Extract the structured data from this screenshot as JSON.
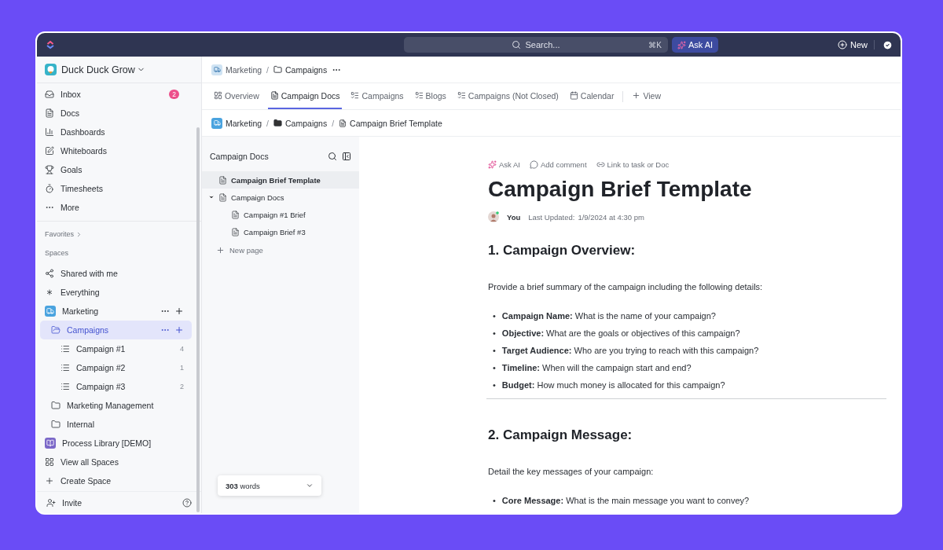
{
  "topbar": {
    "search": {
      "placeholder": "Search..."
    },
    "shortcut": "⌘K",
    "ask_ai": "Ask AI",
    "new": "New"
  },
  "sidebar": {
    "workspace": "Duck Duck Grow",
    "nav": [
      {
        "kind": "inbox",
        "label": "Inbox",
        "badge": "2"
      },
      {
        "kind": "docs",
        "label": "Docs"
      },
      {
        "kind": "dashboards",
        "label": "Dashboards"
      },
      {
        "kind": "whiteboards",
        "label": "Whiteboards"
      },
      {
        "kind": "goals",
        "label": "Goals"
      },
      {
        "kind": "timesheets",
        "label": "Timesheets"
      },
      {
        "kind": "more",
        "label": "More"
      }
    ],
    "favorites": "Favorites",
    "spaces_label": "Spaces",
    "spaces": [
      {
        "kind": "share",
        "label": "Shared with me",
        "selected": false,
        "actions": false
      },
      {
        "kind": "everything",
        "label": "Everything",
        "selected": false,
        "actions": false
      },
      {
        "kind": "space",
        "label": "Marketing",
        "color": "#4aa3df",
        "selected": false,
        "actions": true,
        "children": [
          {
            "kind": "folder",
            "label": "Campaigns",
            "selected": true,
            "actions": true,
            "children": [
              {
                "kind": "list",
                "label": "Campaign #1",
                "count": "4",
                "selected": false,
                "actions": false
              },
              {
                "kind": "list",
                "label": "Campaign #2",
                "count": "1",
                "selected": false,
                "actions": false
              },
              {
                "kind": "list",
                "label": "Campaign #3",
                "count": "2",
                "selected": false,
                "actions": false
              }
            ]
          },
          {
            "kind": "folder",
            "label": "Marketing Management",
            "selected": false,
            "actions": false
          },
          {
            "kind": "folder",
            "label": "Internal",
            "selected": false,
            "actions": false
          }
        ]
      },
      {
        "kind": "space",
        "label": "Process Library [DEMO]",
        "color": "#7b68c8",
        "selected": false,
        "actions": false
      },
      {
        "kind": "grid",
        "label": "View all Spaces",
        "selected": false,
        "actions": false
      },
      {
        "kind": "plus",
        "label": "Create Space",
        "selected": false,
        "actions": false
      }
    ],
    "invite": "Invite"
  },
  "header": {
    "breadcrumb": [
      {
        "label": "Marketing"
      },
      {
        "separator": "/",
        "label": "Campaigns"
      }
    ]
  },
  "tabs": [
    {
      "kind": "overview",
      "label": "Overview",
      "selected": false
    },
    {
      "kind": "doc",
      "label": "Campaign Docs",
      "selected": true
    },
    {
      "kind": "list",
      "label": "Campaigns",
      "selected": false
    },
    {
      "kind": "list",
      "label": "Blogs",
      "selected": false
    },
    {
      "kind": "list",
      "label": "Campaigns (Not Closed)",
      "selected": false
    },
    {
      "kind": "calendar",
      "label": "Calendar",
      "selected": false
    },
    {
      "kind": "add",
      "label": "View",
      "selected": false
    }
  ],
  "breadcrumb": [
    {
      "kind": "space",
      "label": "Marketing"
    },
    {
      "kind": "folder",
      "separator": "/",
      "label": "Campaigns"
    },
    {
      "kind": "doc",
      "separator": "/",
      "label": "Campaign Brief Template"
    }
  ],
  "doc_panel": {
    "title": "Campaign Docs",
    "pages": [
      {
        "label": "Campaign Brief Template",
        "selected": true,
        "expanded": false
      },
      {
        "label": "Campaign Docs",
        "selected": false,
        "expanded": true,
        "children": [
          {
            "label": "Campaign #1 Brief",
            "selected": false,
            "expanded": false
          },
          {
            "label": "Campaign Brief #3",
            "selected": false,
            "expanded": false
          }
        ]
      }
    ],
    "new_page": "New page"
  },
  "doc": {
    "actions": [
      {
        "kind": "ai",
        "label": "Ask AI"
      },
      {
        "kind": "comment",
        "label": "Add comment"
      },
      {
        "kind": "link",
        "label": "Link to task or Doc"
      }
    ],
    "title": "Campaign Brief Template",
    "author": "You",
    "updated_label": "Last Updated:",
    "updated": "1/9/2024 at 4:30 pm",
    "sections": [
      {
        "heading": "1. Campaign Overview:",
        "intro": "Provide a brief summary of the campaign including the following details:",
        "bullets": [
          {
            "marker": "•",
            "text": "**Campaign Name:** What is the name of your campaign?"
          },
          {
            "marker": "•",
            "text": "**Objective:** What are the goals or objectives of this campaign?"
          },
          {
            "marker": "•",
            "text": "**Target Audience:** Who are you trying to reach with this campaign?"
          },
          {
            "marker": "•",
            "text": "**Timeline:** When will the campaign start and end?"
          },
          {
            "marker": "•",
            "text": "**Budget:** How much money is allocated for this campaign?"
          }
        ],
        "divider": true
      },
      {
        "heading": "2. Campaign Message:",
        "intro": "Detail the key messages of your campaign:",
        "bullets": [
          {
            "marker": "•",
            "text": "**Core Message:** What is the main message you want to convey?"
          }
        ]
      }
    ]
  },
  "word_count": "**303** words"
}
